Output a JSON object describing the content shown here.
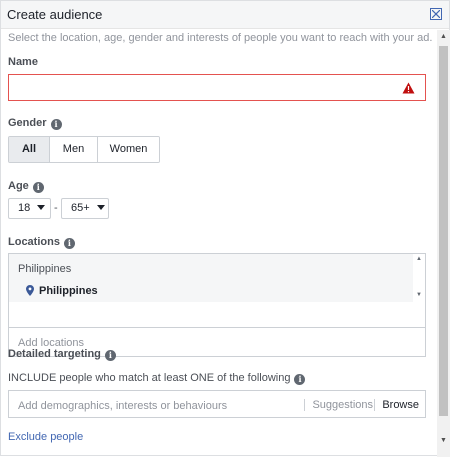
{
  "header": {
    "title": "Create audience"
  },
  "subtitle": "Select the location, age, gender and interests of people you want to reach with your ad.",
  "name": {
    "label": "Name",
    "value": ""
  },
  "gender": {
    "label": "Gender",
    "options": [
      "All",
      "Men",
      "Women"
    ],
    "selected": "All"
  },
  "age": {
    "label": "Age",
    "min": "18",
    "separator": "-",
    "max": "65+"
  },
  "locations": {
    "label": "Locations",
    "group_heading": "Philippines",
    "selected_item": "Philippines",
    "placeholder": "Add locations"
  },
  "detailed_targeting": {
    "label": "Detailed targeting",
    "include_label": "INCLUDE people who match at least ONE of the following",
    "placeholder": "Add demographics, interests or behaviours",
    "suggestions_label": "Suggestions",
    "browse_label": "Browse"
  },
  "exclude_link": "Exclude people",
  "colors": {
    "accent": "#4267b2",
    "error": "#e4524f",
    "warning": "#c00f0f",
    "pin": "#3b5998"
  },
  "icons": [
    "close-icon",
    "warning-icon",
    "info-icon",
    "chevron-down-icon",
    "location-pin-icon"
  ]
}
